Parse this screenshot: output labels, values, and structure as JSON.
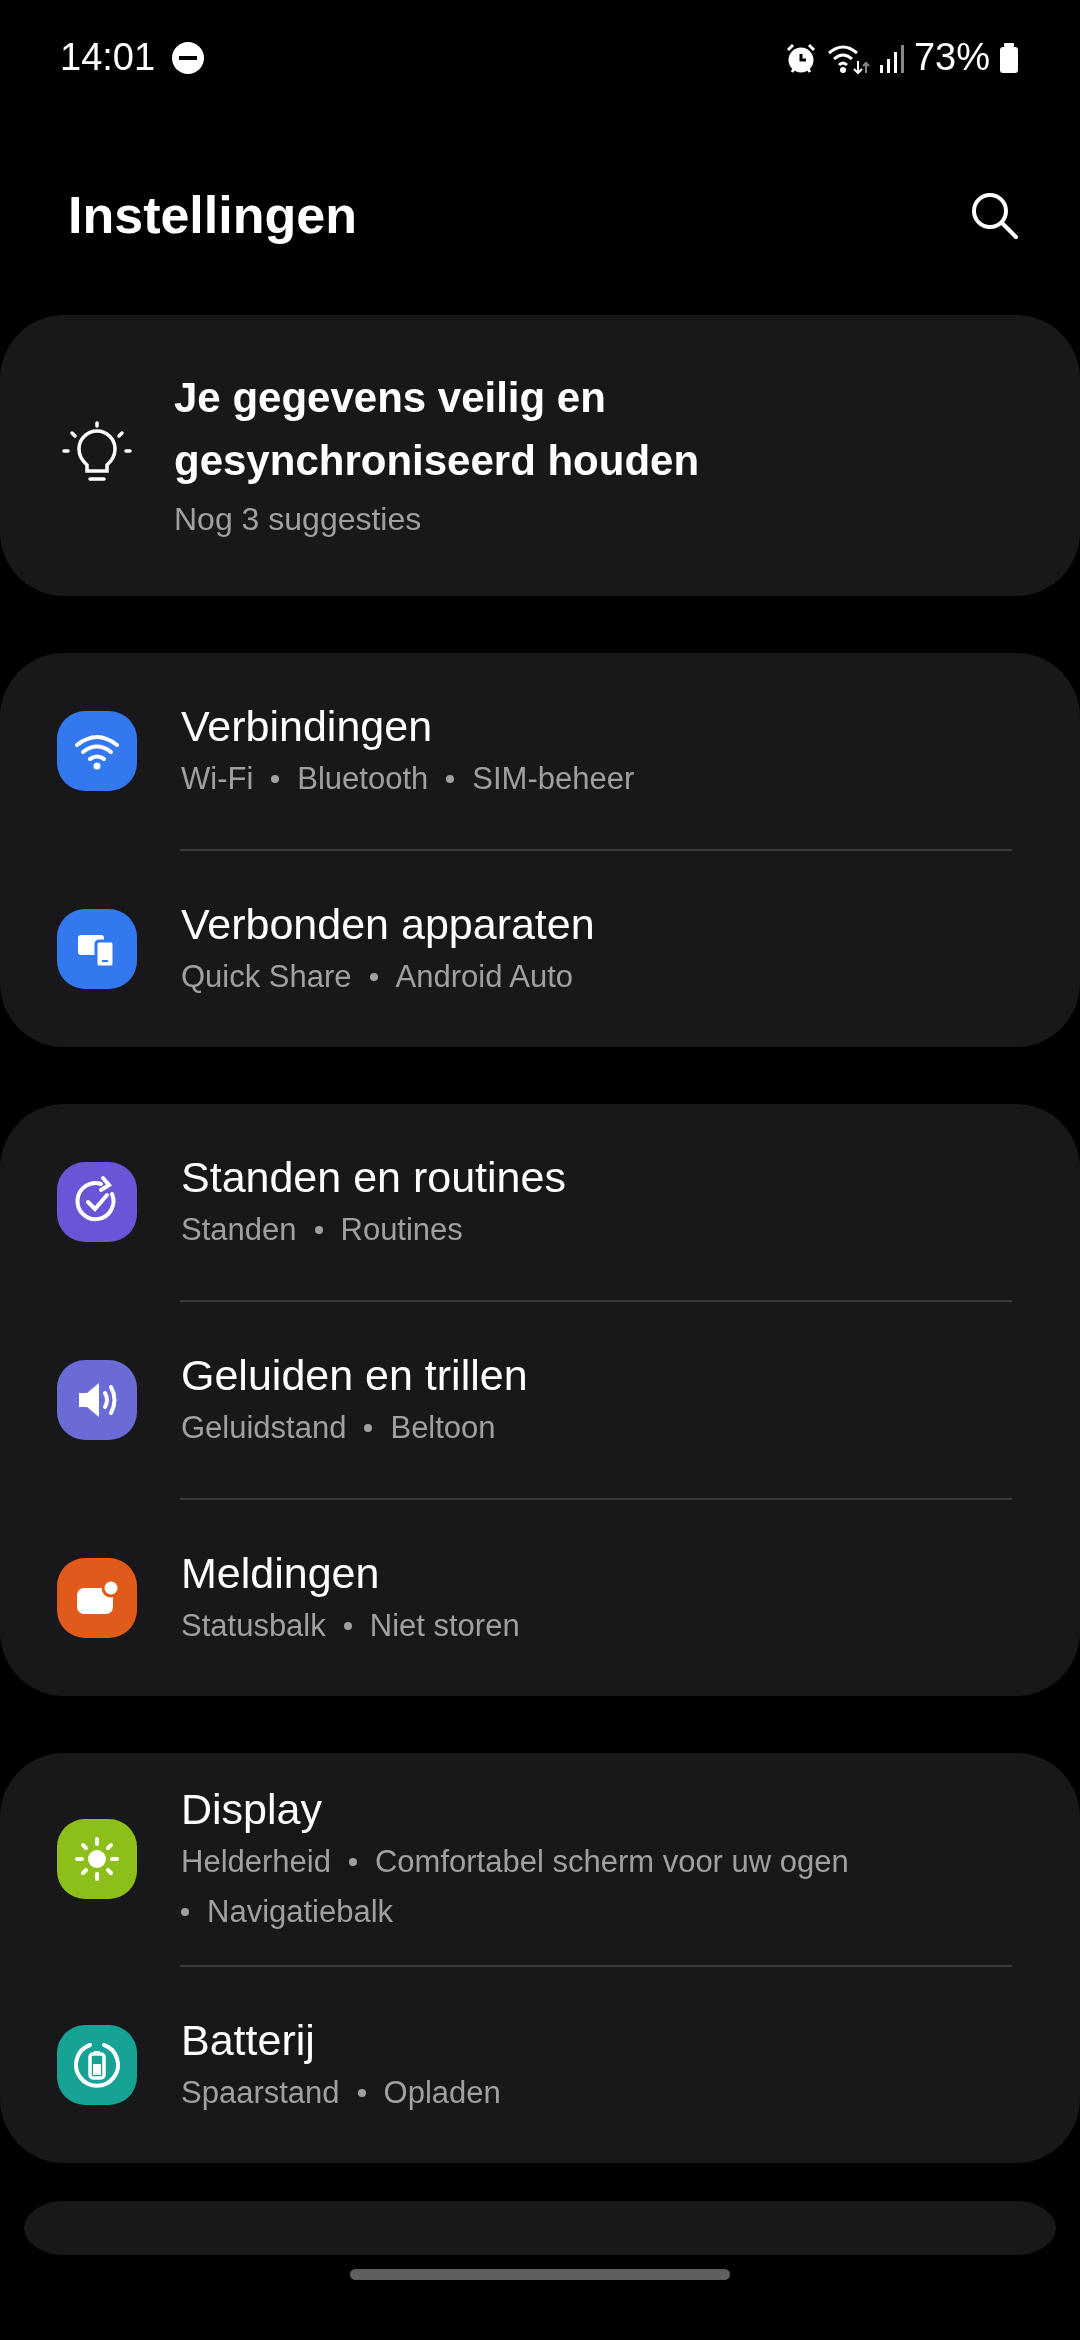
{
  "status_bar": {
    "time": "14:01",
    "battery": "73%"
  },
  "header": {
    "title": "Instellingen"
  },
  "suggestion": {
    "title": "Je gegevens veilig en gesynchroniseerd houden",
    "subtitle": "Nog 3 suggesties"
  },
  "groups": [
    {
      "items": [
        {
          "kind": "wifi",
          "color": "#3478f0",
          "title": "Verbindingen",
          "details": [
            "Wi-Fi",
            "Bluetooth",
            "SIM-beheer"
          ]
        },
        {
          "kind": "devices",
          "color": "#3478f0",
          "title": "Verbonden apparaten",
          "details": [
            "Quick Share",
            "Android Auto"
          ]
        }
      ]
    },
    {
      "items": [
        {
          "kind": "modes",
          "color": "#6a55d6",
          "title": "Standen en routines",
          "details": [
            "Standen",
            "Routines"
          ]
        },
        {
          "kind": "sound",
          "color": "#6b6bd8",
          "title": "Geluiden en trillen",
          "details": [
            "Geluidstand",
            "Beltoon"
          ]
        },
        {
          "kind": "notifications",
          "color": "#e05a1c",
          "title": "Meldingen",
          "details": [
            "Statusbalk",
            "Niet storen"
          ]
        }
      ]
    },
    {
      "items": [
        {
          "kind": "display",
          "color": "#8cbf1a",
          "title": "Display",
          "details": [
            "Helderheid",
            "Comfortabel scherm voor uw ogen",
            "Navigatiebalk"
          ]
        },
        {
          "kind": "battery",
          "color": "#17a394",
          "title": "Batterij",
          "details": [
            "Spaarstand",
            "Opladen"
          ]
        }
      ]
    }
  ]
}
